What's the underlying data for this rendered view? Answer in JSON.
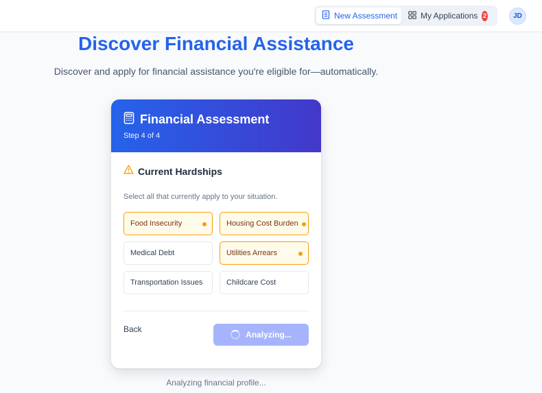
{
  "nav": {
    "new_assessment": "New Assessment",
    "my_applications": "My Applications",
    "applications_count": "2",
    "avatar_initials": "JD"
  },
  "hero": {
    "title": "Discover Financial Assistance",
    "subtitle": "Discover and apply for financial assistance you're eligible for—automatically."
  },
  "card": {
    "title": "Financial Assessment",
    "step": "Step 4 of 4",
    "section_title": "Current Hardships",
    "section_desc": "Select all that currently apply to your situation.",
    "options": [
      {
        "label": "Food Insecurity",
        "selected": true
      },
      {
        "label": "Housing Cost Burden",
        "selected": true
      },
      {
        "label": "Medical Debt",
        "selected": false
      },
      {
        "label": "Utilities Arrears",
        "selected": true
      },
      {
        "label": "Transportation Issues",
        "selected": false
      },
      {
        "label": "Childcare Cost",
        "selected": false
      }
    ],
    "back_label": "Back",
    "analyze_label": "Analyzing..."
  },
  "status_text": "Analyzing financial profile...",
  "colors": {
    "primary": "#2563eb",
    "selected_border": "#f59e0b",
    "badge": "#ef4444"
  }
}
